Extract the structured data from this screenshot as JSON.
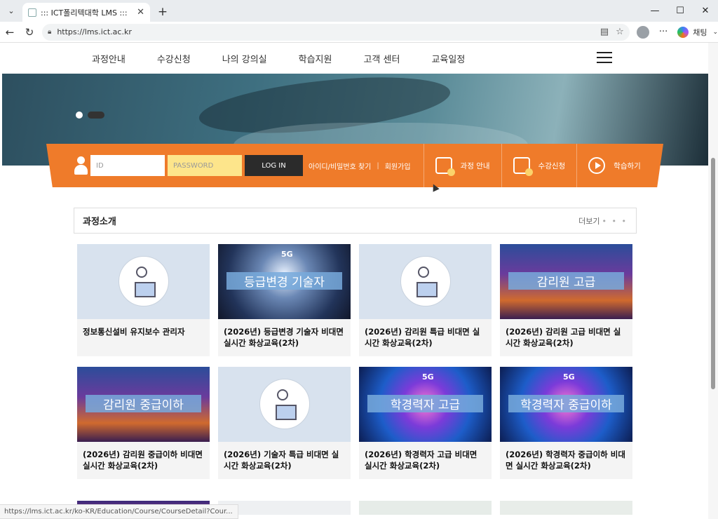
{
  "browser": {
    "tab_title": "::: ICT폴리텍대학 LMS :::",
    "url": "https://lms.ict.ac.kr",
    "copilot_label": "채팅",
    "status_url": "https://lms.ict.ac.kr/ko-KR/Education/Course/CourseDetail?Cour..."
  },
  "nav": {
    "items": [
      "과정안내",
      "수강신청",
      "나의 강의실",
      "학습지원",
      "고객 센터",
      "교육일정"
    ]
  },
  "login": {
    "id_placeholder": "ID",
    "pw_placeholder": "PASSWORD",
    "login_label": "LOG IN",
    "find_label": "아이디/비밀번호 찾기",
    "join_label": "회원가입"
  },
  "quick": {
    "course": "과정 안내",
    "apply": "수강신청",
    "study": "학습하기"
  },
  "section": {
    "title": "과정소개",
    "more": "더보기"
  },
  "courses": [
    {
      "title": "정보통신설비 유지보수 관리자",
      "thumb_label": ""
    },
    {
      "title": "(2026년) 등급변경 기술자 비대면 실시간 화상교육(2차)",
      "thumb_label": "등급변경 기술자"
    },
    {
      "title": "(2026년) 감리원 특급 비대면 실시간 화상교육(2차)",
      "thumb_label": ""
    },
    {
      "title": "(2026년) 감리원 고급 비대면 실시간 화상교육(2차)",
      "thumb_label": "감리원 고급"
    },
    {
      "title": "(2026년) 감리원 중급이하 비대면 실시간 화상교육(2차)",
      "thumb_label": "감리원 중급이하"
    },
    {
      "title": "(2026년) 기술자 특급 비대면 실시간 화상교육(2차)",
      "thumb_label": ""
    },
    {
      "title": "(2026년) 학경력자 고급 비대면 실시간 화상교육(2차)",
      "thumb_label": "학경력자 고급"
    },
    {
      "title": "(2026년) 학경력자 중급이하 비대면 실시간 화상교육(2차)",
      "thumb_label": "학경력자 중급이하"
    }
  ],
  "thumb_badge": "5G"
}
